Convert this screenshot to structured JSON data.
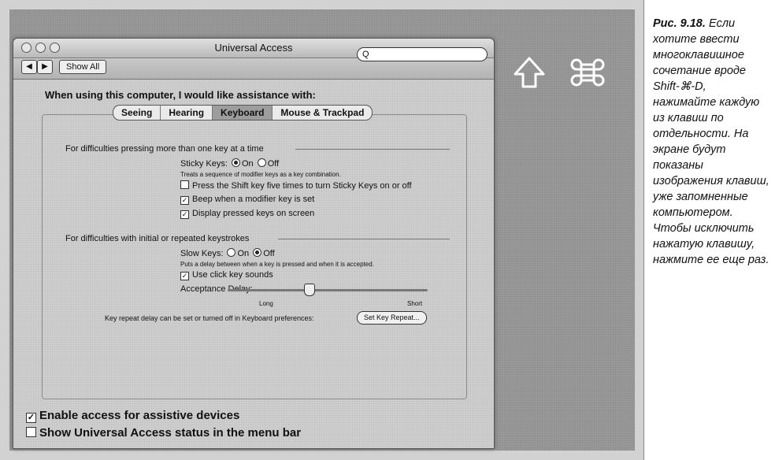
{
  "window": {
    "title": "Universal Access",
    "show_all": "Show All",
    "search_icon": "magnifier-icon",
    "search_placeholder": "Q"
  },
  "prompt": "When using this computer, I would like assistance with:",
  "tabs": [
    {
      "label": "Seeing"
    },
    {
      "label": "Hearing"
    },
    {
      "label": "Keyboard"
    },
    {
      "label": "Mouse & Trackpad"
    }
  ],
  "sticky": {
    "section": "For difficulties pressing more than one key at a time",
    "label": "Sticky Keys:",
    "on": "On",
    "off": "Off",
    "desc": "Treats a sequence of modifier keys as a key combination.",
    "opt1": "Press the Shift key five times to turn Sticky Keys on or off",
    "opt2": "Beep when a modifier key is set",
    "opt3": "Display pressed keys on screen"
  },
  "slow": {
    "section": "For difficulties with initial or repeated keystrokes",
    "label": "Slow Keys:",
    "on": "On",
    "off": "Off",
    "desc": "Puts a delay between when a key is pressed and when it is accepted.",
    "opt1": "Use click key sounds",
    "delay_label": "Acceptance Delay:",
    "long": "Long",
    "short": "Short",
    "delay_value": 0.4
  },
  "repeat": {
    "text": "Key repeat delay can be set or turned off in Keyboard preferences:",
    "button": "Set Key Repeat..."
  },
  "bottom": {
    "assistive": "Enable access for assistive devices",
    "status": "Show Universal Access status in the menu bar"
  },
  "overlay_icons": [
    "shift-key-icon",
    "command-key-icon"
  ],
  "caption": {
    "fig": "Рис. 9.18.",
    "text": "Если хотите ввести многоклавишное сочетание вроде Shift-⌘-D, нажимайте каждую из клавиш по отдельности. На экране будут показаны изображения клавиш, уже запомненные компьютером. Чтобы исключить нажатую клавишу, нажмите ее еще раз."
  }
}
